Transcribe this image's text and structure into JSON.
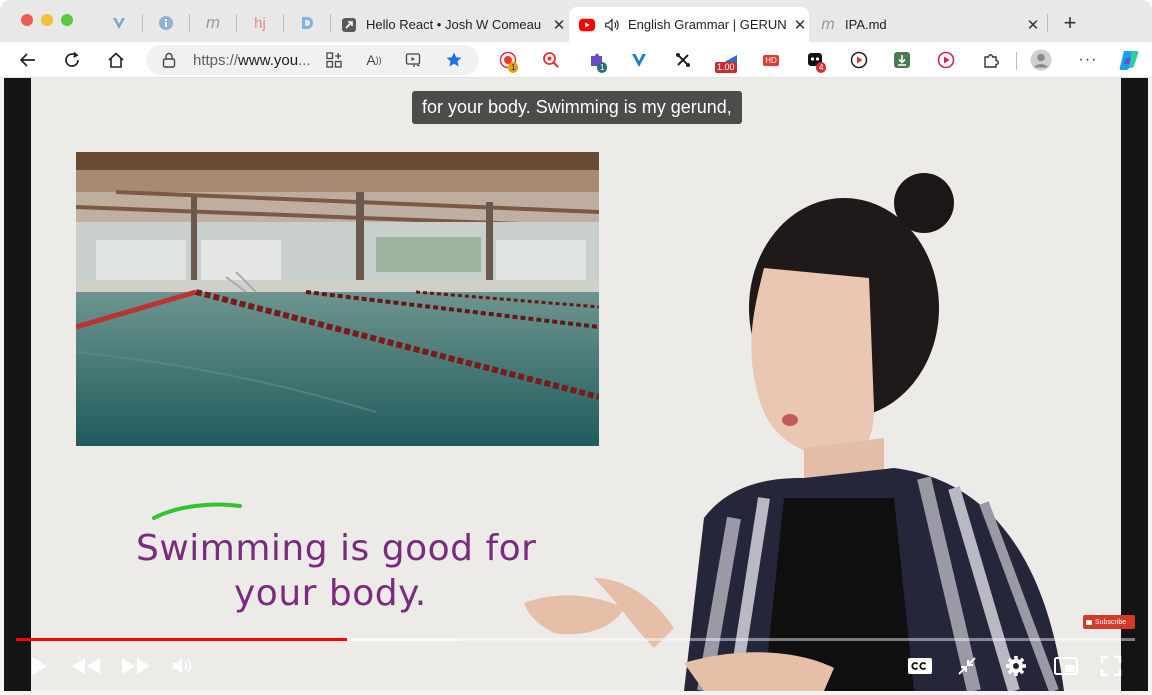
{
  "browser": {
    "tabs": [
      {
        "title": "Hello React • Josh W Comeau",
        "favicon": "arrow-square-icon"
      },
      {
        "title": "English Grammar | GERUN",
        "favicon": "youtube-icon",
        "active": true,
        "audio": true
      },
      {
        "title": "IPA.md",
        "favicon": "markdown-m-icon"
      }
    ],
    "pinned_tabs": [
      "vivaldi-v-icon",
      "info-circle-icon",
      "m-icon",
      "hj-icon",
      "d-icon"
    ],
    "new_tab_label": "+",
    "address": {
      "prefix": "https://",
      "host": "www.you",
      "ellipsis": "..."
    },
    "extension_badges": {
      "first": "1",
      "second": "1",
      "speed": "1.00",
      "hd": "HD",
      "fourth": "4"
    }
  },
  "video": {
    "caption": "for your body. Swimming is my gerund,",
    "lesson_line1": "Swimming is good for",
    "lesson_line2": "your body.",
    "subscribe_label": "Subscribe",
    "time_current": "2:11",
    "time_separator": "/",
    "time_total": "7:24",
    "progress_played": 0.296,
    "progress_buffered": 0.395,
    "controls": [
      "play-icon",
      "previous-icon",
      "next-icon",
      "volume-icon",
      "cc-icon",
      "exit-fullscreen-small-icon",
      "settings-icon",
      "miniplayer-icon",
      "fullscreen-icon"
    ]
  },
  "colors": {
    "lesson_text": "#7b2b7f",
    "underline": "#2ec52e",
    "progress": "#ff0000",
    "star": "#1a73e8"
  }
}
